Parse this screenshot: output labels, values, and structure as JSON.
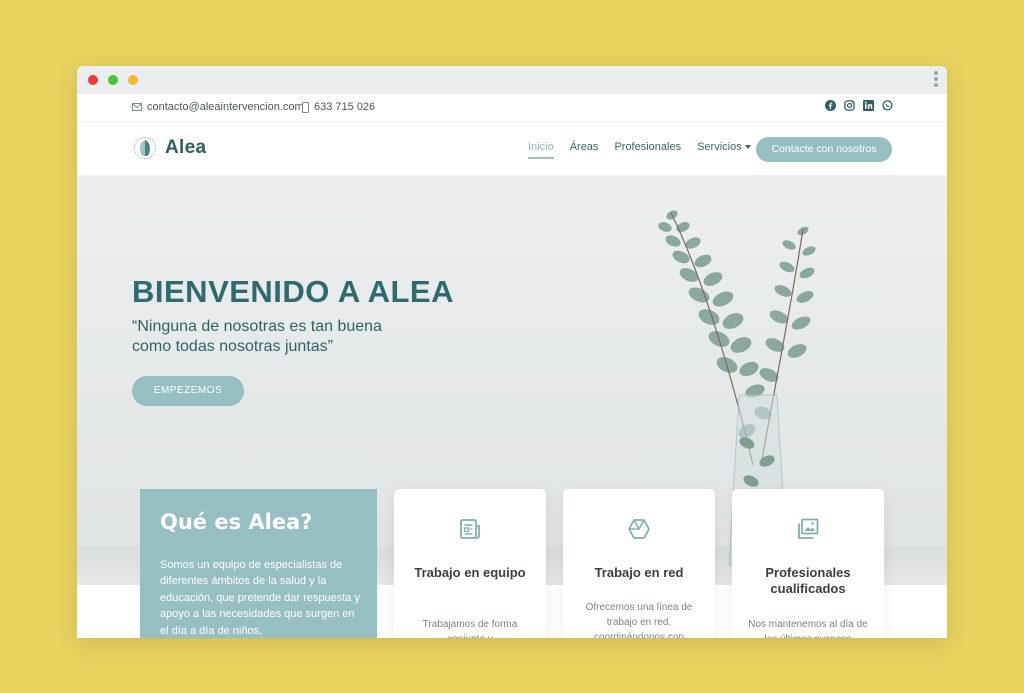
{
  "topbar": {
    "email": "contacto@aleaintervencion.com",
    "phone": "633 715 026",
    "socials": [
      "facebook-icon",
      "instagram-icon",
      "linkedin-icon",
      "whatsapp-icon"
    ]
  },
  "brand": {
    "name": "Alea"
  },
  "nav": {
    "items": [
      "Inicio",
      "Áreas",
      "Profesionales",
      "Servicios"
    ],
    "active": "Inicio",
    "cta": "Contacte con nosotros"
  },
  "hero": {
    "title": "BIENVENIDO A ALEA",
    "quote_line1": "“Ninguna de nosotras es tan buena",
    "quote_line2": "como todas nosotras juntas”",
    "button": "EMPEZEMOS"
  },
  "about": {
    "title": "Qué es Alea?",
    "text": "Somos un equipo de especialistas de diferentes ámbitos de la salud y la educación, que pretende dar respuesta y apoyo a las necesidades que surgen en el día a día de niños,"
  },
  "cards": [
    {
      "icon": "document-icon",
      "title": "Trabajo en equipo",
      "text": "Trabajamos de forma conjunta y"
    },
    {
      "icon": "cube-icon",
      "title": "Trabajo en red",
      "text": "Ofrecemos una línea de trabajo en red, coordinándonos con"
    },
    {
      "icon": "images-icon",
      "title": "Profesionales cualificados",
      "text": "Nos mantenemos al día de los últimos avances"
    }
  ],
  "colors": {
    "accent": "#96bfc1",
    "heading": "#2f6a6d",
    "background": "#e8d35f"
  }
}
